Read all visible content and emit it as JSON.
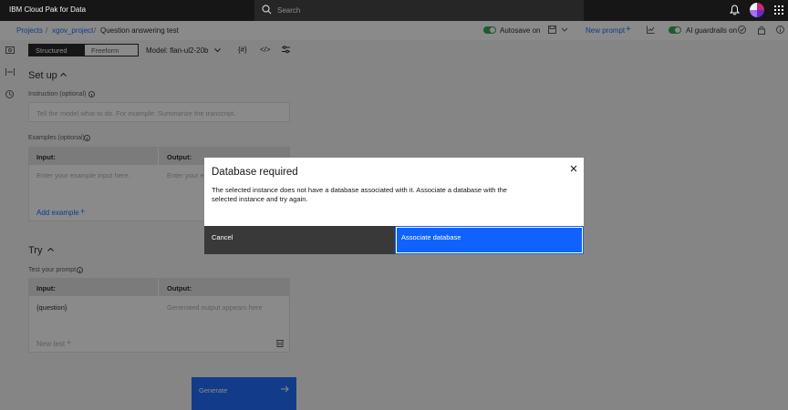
{
  "app": {
    "brand": "IBM Cloud Pak for Data",
    "search_placeholder": "Search"
  },
  "breadcrumb": {
    "items": [
      "Projects",
      "xgov_project",
      "Question answering test"
    ],
    "separator": "/"
  },
  "subheader": {
    "autosave": "Autosave on",
    "new_prompt": "New prompt",
    "guardrails": "AI guardrails on"
  },
  "editor": {
    "mode_structured": "Structured",
    "mode_freeform": "Freeform",
    "model": "Model: flan-ul2-20b",
    "setup_title": "Set up",
    "instruction_label": "Instruction (optional)",
    "instruction_placeholder": "Tell the model what to do. For example: Summarize the transcript.",
    "examples_label": "Examples (optional)",
    "input_header": "Input:",
    "output_header": "Output:",
    "example_input_placeholder": "Enter your example input here.",
    "example_output_placeholder": "Enter your e",
    "add_example": "Add example",
    "try_title": "Try",
    "test_prompt_label": "Test your prompt",
    "test_input_value": "{question}",
    "test_output_placeholder": "Generated output appears here",
    "new_test": "New test",
    "generate": "Generate"
  },
  "modal": {
    "title": "Database required",
    "body": "The selected instance does not have a database associated with it. Associate a database with the selected instance and try again.",
    "cancel": "Cancel",
    "primary": "Associate database"
  },
  "colors": {
    "primary": "#0f62fe",
    "toggle_on": "#24a148",
    "topbar": "#161616"
  },
  "icons": [
    "search-icon",
    "bell-icon",
    "apps-grid-icon",
    "close-icon",
    "chevron-down-icon",
    "info-icon",
    "trash-icon",
    "arrow-right-icon",
    "plus-icon"
  ]
}
